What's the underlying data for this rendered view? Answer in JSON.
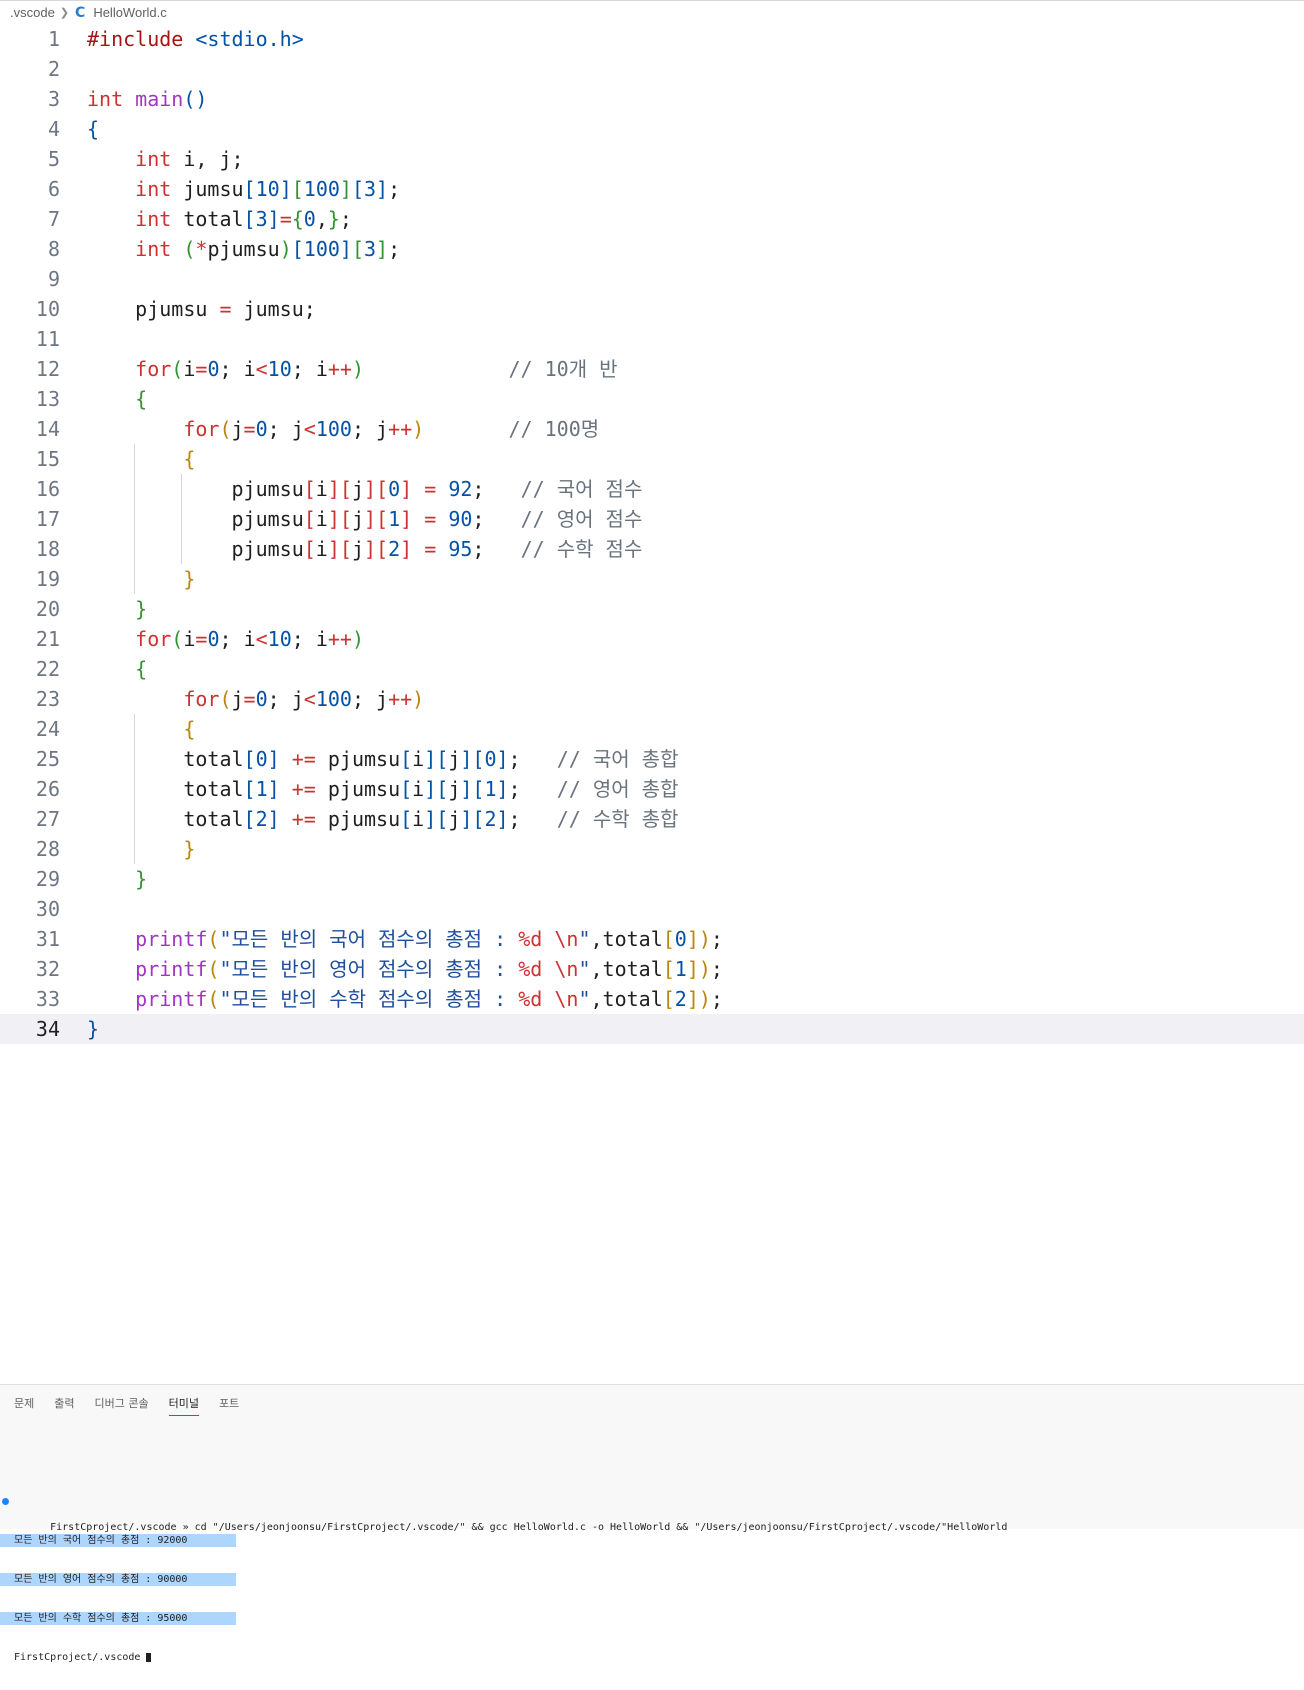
{
  "breadcrumb": {
    "folder": ".vscode",
    "file": "HelloWorld.c"
  },
  "editor": {
    "current_line": "34",
    "line_numbers": [
      "1",
      "2",
      "3",
      "4",
      "5",
      "6",
      "7",
      "8",
      "9",
      "10",
      "11",
      "12",
      "13",
      "14",
      "15",
      "16",
      "17",
      "18",
      "19",
      "20",
      "21",
      "22",
      "23",
      "24",
      "25",
      "26",
      "27",
      "28",
      "29",
      "30",
      "31",
      "32",
      "33",
      "34"
    ],
    "code": [
      [
        [
          "#include",
          "pp"
        ],
        [
          " "
        ],
        [
          "<stdio.h>",
          "inc"
        ]
      ],
      [],
      [
        [
          "int",
          "kw"
        ],
        [
          " "
        ],
        [
          "main",
          "pf"
        ],
        [
          "()",
          "b1"
        ]
      ],
      [
        [
          "{",
          "b1"
        ]
      ],
      [
        [
          "    "
        ],
        [
          "int",
          "kw"
        ],
        [
          " i, j;"
        ]
      ],
      [
        [
          "    "
        ],
        [
          "int",
          "kw"
        ],
        [
          " jumsu"
        ],
        [
          "[",
          "b1"
        ],
        [
          "10",
          "num"
        ],
        [
          "]",
          "b1"
        ],
        [
          "[",
          "b2"
        ],
        [
          "100",
          "num"
        ],
        [
          "]",
          "b2"
        ],
        [
          "[",
          "b1"
        ],
        [
          "3",
          "num"
        ],
        [
          "]",
          "b1"
        ],
        [
          ";"
        ]
      ],
      [
        [
          "    "
        ],
        [
          "int",
          "kw"
        ],
        [
          " total"
        ],
        [
          "[",
          "b1"
        ],
        [
          "3",
          "num"
        ],
        [
          "]",
          "b1"
        ],
        [
          "=",
          "op"
        ],
        [
          "{",
          "b2"
        ],
        [
          "0",
          "num"
        ],
        [
          ","
        ],
        [
          "}",
          "b2"
        ],
        [
          ";"
        ]
      ],
      [
        [
          "    "
        ],
        [
          "int",
          "kw"
        ],
        [
          " "
        ],
        [
          "(",
          "b2"
        ],
        [
          "*",
          "op"
        ],
        [
          "pjumsu"
        ],
        [
          ")",
          "b2"
        ],
        [
          "[",
          "b1"
        ],
        [
          "100",
          "num"
        ],
        [
          "]",
          "b1"
        ],
        [
          "[",
          "b2"
        ],
        [
          "3",
          "num"
        ],
        [
          "]",
          "b2"
        ],
        [
          ";"
        ]
      ],
      [],
      [
        [
          "    pjumsu "
        ],
        [
          "=",
          "op"
        ],
        [
          " jumsu;"
        ]
      ],
      [],
      [
        [
          "    "
        ],
        [
          "for",
          "kw"
        ],
        [
          "(",
          "b2"
        ],
        [
          "i"
        ],
        [
          "=",
          "op"
        ],
        [
          "0",
          "num"
        ],
        [
          "; i"
        ],
        [
          "<",
          "op"
        ],
        [
          "10",
          "num"
        ],
        [
          "; i"
        ],
        [
          "++",
          "op"
        ],
        [
          ")",
          "b2"
        ],
        [
          "            "
        ],
        [
          "// 10개 반",
          "cm"
        ]
      ],
      [
        [
          "    "
        ],
        [
          "{",
          "b2"
        ]
      ],
      [
        [
          "        "
        ],
        [
          "for",
          "kw"
        ],
        [
          "(",
          "b3"
        ],
        [
          "j"
        ],
        [
          "=",
          "op"
        ],
        [
          "0",
          "num"
        ],
        [
          "; j"
        ],
        [
          "<",
          "op"
        ],
        [
          "100",
          "num"
        ],
        [
          "; j"
        ],
        [
          "++",
          "op"
        ],
        [
          ")",
          "b3"
        ],
        [
          "       "
        ],
        [
          "// 100명",
          "cm"
        ]
      ],
      [
        [
          "        "
        ],
        [
          "{",
          "b3"
        ]
      ],
      [
        [
          "            pjumsu"
        ],
        [
          "[",
          "kw"
        ],
        [
          "i"
        ],
        [
          "]",
          "kw"
        ],
        [
          "[",
          "kw"
        ],
        [
          "j"
        ],
        [
          "]",
          "kw"
        ],
        [
          "[",
          "kw"
        ],
        [
          "0",
          "num"
        ],
        [
          "]",
          "kw"
        ],
        [
          " "
        ],
        [
          "=",
          "op"
        ],
        [
          " "
        ],
        [
          "92",
          "num"
        ],
        [
          ";   "
        ],
        [
          "// 국어 점수",
          "cm"
        ]
      ],
      [
        [
          "            pjumsu"
        ],
        [
          "[",
          "kw"
        ],
        [
          "i"
        ],
        [
          "]",
          "kw"
        ],
        [
          "[",
          "kw"
        ],
        [
          "j"
        ],
        [
          "]",
          "kw"
        ],
        [
          "[",
          "kw"
        ],
        [
          "1",
          "num"
        ],
        [
          "]",
          "kw"
        ],
        [
          " "
        ],
        [
          "=",
          "op"
        ],
        [
          " "
        ],
        [
          "90",
          "num"
        ],
        [
          ";   "
        ],
        [
          "// 영어 점수",
          "cm"
        ]
      ],
      [
        [
          "            pjumsu"
        ],
        [
          "[",
          "kw"
        ],
        [
          "i"
        ],
        [
          "]",
          "kw"
        ],
        [
          "[",
          "kw"
        ],
        [
          "j"
        ],
        [
          "]",
          "kw"
        ],
        [
          "[",
          "kw"
        ],
        [
          "2",
          "num"
        ],
        [
          "]",
          "kw"
        ],
        [
          " "
        ],
        [
          "=",
          "op"
        ],
        [
          " "
        ],
        [
          "95",
          "num"
        ],
        [
          ";   "
        ],
        [
          "// 수학 점수",
          "cm"
        ]
      ],
      [
        [
          "        "
        ],
        [
          "}",
          "b3"
        ]
      ],
      [
        [
          "    "
        ],
        [
          "}",
          "b2"
        ]
      ],
      [
        [
          "    "
        ],
        [
          "for",
          "kw"
        ],
        [
          "(",
          "b2"
        ],
        [
          "i"
        ],
        [
          "=",
          "op"
        ],
        [
          "0",
          "num"
        ],
        [
          "; i"
        ],
        [
          "<",
          "op"
        ],
        [
          "10",
          "num"
        ],
        [
          "; i"
        ],
        [
          "++",
          "op"
        ],
        [
          ")",
          "b2"
        ]
      ],
      [
        [
          "    "
        ],
        [
          "{",
          "b2"
        ]
      ],
      [
        [
          "        "
        ],
        [
          "for",
          "kw"
        ],
        [
          "(",
          "b3"
        ],
        [
          "j"
        ],
        [
          "=",
          "op"
        ],
        [
          "0",
          "num"
        ],
        [
          "; j"
        ],
        [
          "<",
          "op"
        ],
        [
          "100",
          "num"
        ],
        [
          "; j"
        ],
        [
          "++",
          "op"
        ],
        [
          ")",
          "b3"
        ]
      ],
      [
        [
          "        "
        ],
        [
          "{",
          "b3"
        ]
      ],
      [
        [
          "        total"
        ],
        [
          "[",
          "b1"
        ],
        [
          "0",
          "num"
        ],
        [
          "]",
          "b1"
        ],
        [
          " "
        ],
        [
          "+=",
          "op"
        ],
        [
          " pjumsu"
        ],
        [
          "[",
          "b1"
        ],
        [
          "i"
        ],
        [
          "]",
          "b1"
        ],
        [
          "[",
          "b1"
        ],
        [
          "j"
        ],
        [
          "]",
          "b1"
        ],
        [
          "[",
          "b1"
        ],
        [
          "0",
          "num"
        ],
        [
          "]",
          "b1"
        ],
        [
          ";   "
        ],
        [
          "// 국어 총합",
          "cm"
        ]
      ],
      [
        [
          "        total"
        ],
        [
          "[",
          "b1"
        ],
        [
          "1",
          "num"
        ],
        [
          "]",
          "b1"
        ],
        [
          " "
        ],
        [
          "+=",
          "op"
        ],
        [
          " pjumsu"
        ],
        [
          "[",
          "b1"
        ],
        [
          "i"
        ],
        [
          "]",
          "b1"
        ],
        [
          "[",
          "b1"
        ],
        [
          "j"
        ],
        [
          "]",
          "b1"
        ],
        [
          "[",
          "b1"
        ],
        [
          "1",
          "num"
        ],
        [
          "]",
          "b1"
        ],
        [
          ";   "
        ],
        [
          "// 영어 총합",
          "cm"
        ]
      ],
      [
        [
          "        total"
        ],
        [
          "[",
          "b1"
        ],
        [
          "2",
          "num"
        ],
        [
          "]",
          "b1"
        ],
        [
          " "
        ],
        [
          "+=",
          "op"
        ],
        [
          " pjumsu"
        ],
        [
          "[",
          "b1"
        ],
        [
          "i"
        ],
        [
          "]",
          "b1"
        ],
        [
          "[",
          "b1"
        ],
        [
          "j"
        ],
        [
          "]",
          "b1"
        ],
        [
          "[",
          "b1"
        ],
        [
          "2",
          "num"
        ],
        [
          "]",
          "b1"
        ],
        [
          ";   "
        ],
        [
          "// 수학 총합",
          "cm"
        ]
      ],
      [
        [
          "        "
        ],
        [
          "}",
          "b3"
        ]
      ],
      [
        [
          "    "
        ],
        [
          "}",
          "b2"
        ]
      ],
      [],
      [
        [
          "    "
        ],
        [
          "printf",
          "pf"
        ],
        [
          "(",
          "b3"
        ],
        [
          "\"모든 반의 국어 점수의 총점 : ",
          "str"
        ],
        [
          "%d",
          "esc"
        ],
        [
          " ",
          "str"
        ],
        [
          "\\n",
          "esc"
        ],
        [
          "\"",
          "str"
        ],
        [
          ",total"
        ],
        [
          "[",
          "b3"
        ],
        [
          "0",
          "num"
        ],
        [
          "]",
          "b3"
        ],
        [
          ")",
          "b3"
        ],
        [
          ";"
        ]
      ],
      [
        [
          "    "
        ],
        [
          "printf",
          "pf"
        ],
        [
          "(",
          "b3"
        ],
        [
          "\"모든 반의 영어 점수의 총점 : ",
          "str"
        ],
        [
          "%d",
          "esc"
        ],
        [
          " ",
          "str"
        ],
        [
          "\\n",
          "esc"
        ],
        [
          "\"",
          "str"
        ],
        [
          ",total"
        ],
        [
          "[",
          "b3"
        ],
        [
          "1",
          "num"
        ],
        [
          "]",
          "b3"
        ],
        [
          ")",
          "b3"
        ],
        [
          ";"
        ]
      ],
      [
        [
          "    "
        ],
        [
          "printf",
          "pf"
        ],
        [
          "(",
          "b3"
        ],
        [
          "\"모든 반의 수학 점수의 총점 : ",
          "str"
        ],
        [
          "%d",
          "esc"
        ],
        [
          " ",
          "str"
        ],
        [
          "\\n",
          "esc"
        ],
        [
          "\"",
          "str"
        ],
        [
          ",total"
        ],
        [
          "[",
          "b3"
        ],
        [
          "2",
          "num"
        ],
        [
          "]",
          "b3"
        ],
        [
          ")",
          "b3"
        ],
        [
          ";"
        ]
      ],
      [
        [
          "}",
          "b1"
        ]
      ]
    ]
  },
  "panel": {
    "tabs": [
      "문제",
      "출력",
      "디버그 콘솔",
      "터미널",
      "포트"
    ],
    "active_tab": "터미널"
  },
  "terminal": {
    "command_line": "FirstCproject/.vscode » cd \"/Users/jeonjoonsu/FirstCproject/.vscode/\" && gcc HelloWorld.c -o HelloWorld && \"/Users/jeonjoonsu/FirstCproject/.vscode/\"HelloWorld",
    "output": [
      "모든 반의 국어 점수의 총점 : 92000",
      "모든 반의 영어 점수의 총점 : 90000",
      "모든 반의 수학 점수의 총점 : 95000"
    ],
    "prompt": "FirstCproject/.vscode"
  }
}
